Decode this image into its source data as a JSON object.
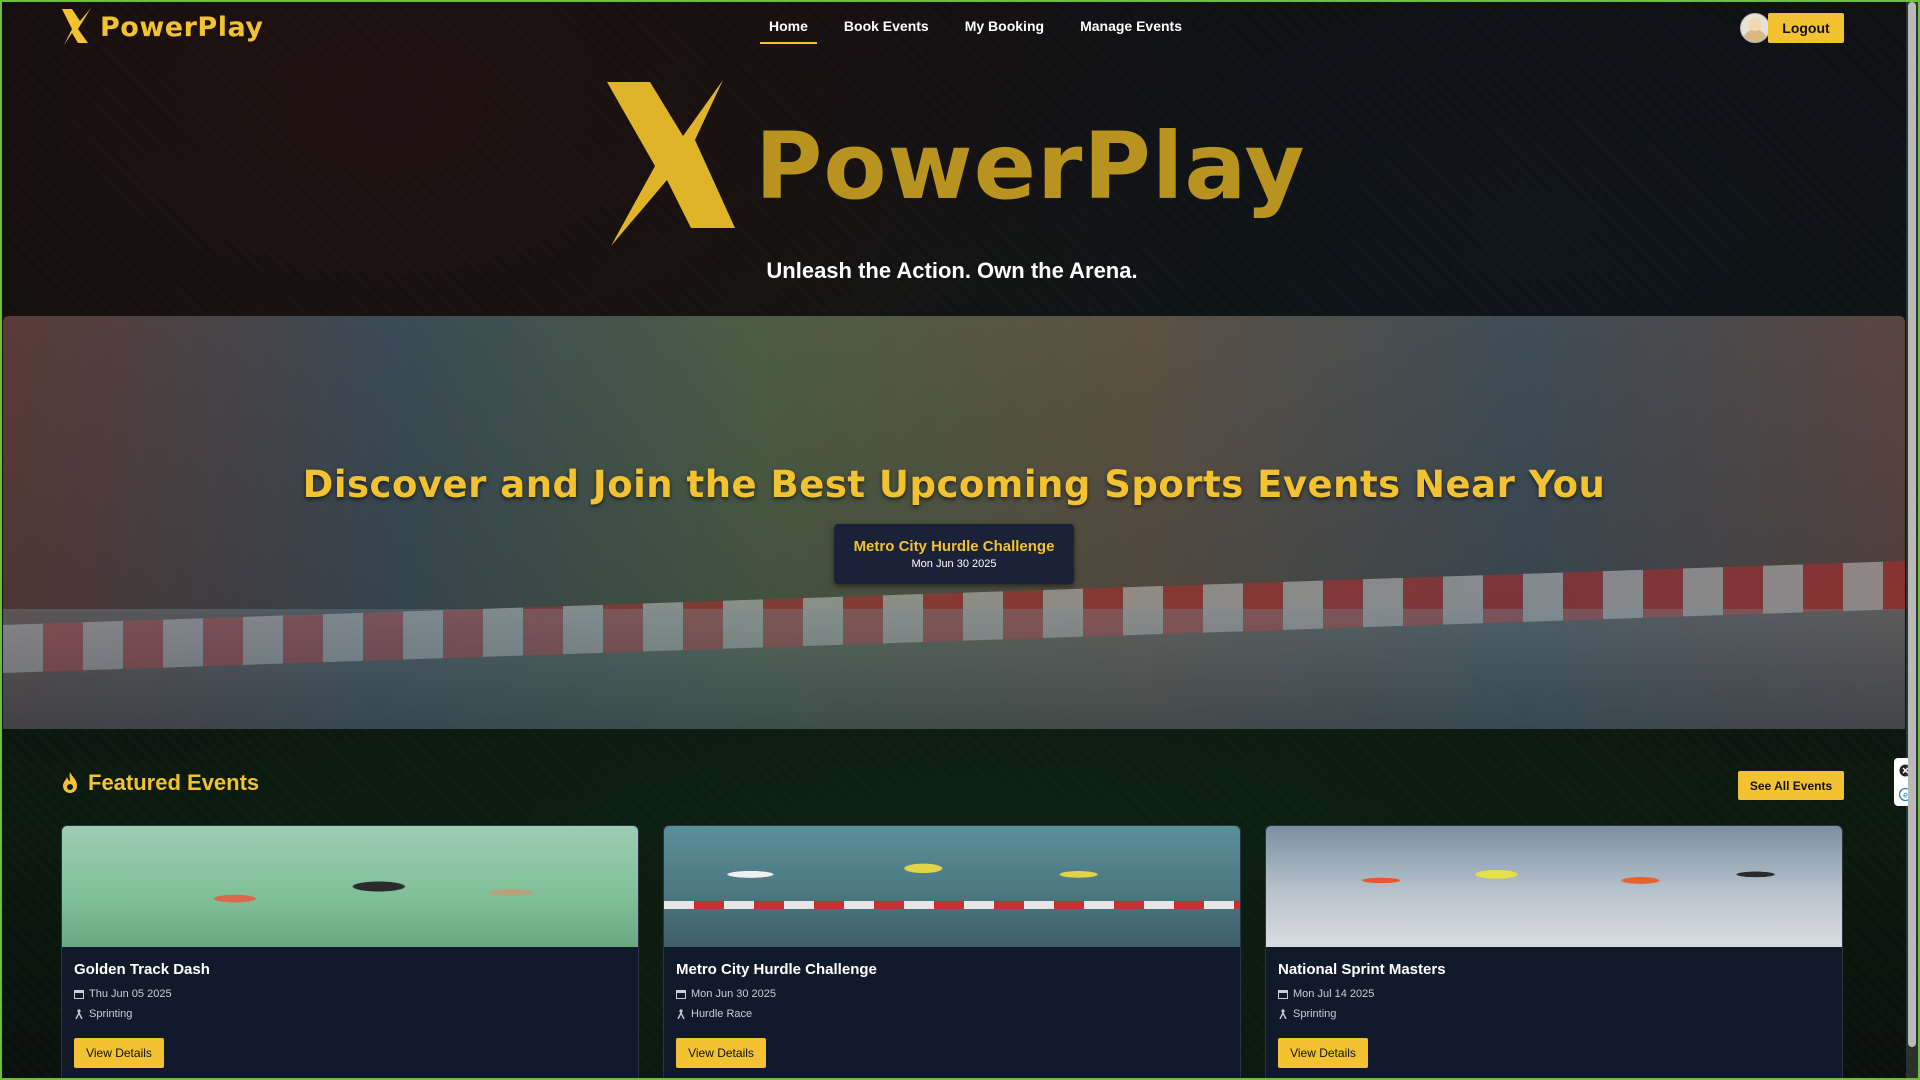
{
  "brand": {
    "name": "PowerPlay"
  },
  "nav": {
    "items": [
      {
        "label": "Home",
        "active": true
      },
      {
        "label": "Book Events",
        "active": false
      },
      {
        "label": "My Booking",
        "active": false
      },
      {
        "label": "Manage Events",
        "active": false
      }
    ],
    "logout_label": "Logout"
  },
  "hero": {
    "name": "PowerPlay",
    "tagline": "Unleash the Action. Own the Arena."
  },
  "banner": {
    "title": "Discover and Join the Best Upcoming Sports Events Near You",
    "event": {
      "title": "Metro City Hurdle Challenge",
      "date": "Mon Jun 30 2025"
    }
  },
  "featured": {
    "title": "Featured Events",
    "see_all_label": "See All Events",
    "events": [
      {
        "title": "Golden Track Dash",
        "date": "Thu Jun 05 2025",
        "category": "Sprinting",
        "button": "View Details"
      },
      {
        "title": "Metro City Hurdle Challenge",
        "date": "Mon Jun 30 2025",
        "category": "Hurdle Race",
        "button": "View Details"
      },
      {
        "title": "National Sprint Masters",
        "date": "Mon Jul 14 2025",
        "category": "Sprinting",
        "button": "View Details"
      }
    ]
  },
  "colors": {
    "accent": "#f2c230",
    "card_bg": "#111a2a",
    "frame": "#6fbf3a"
  },
  "icons": [
    "lightning-x-logo",
    "fire-icon",
    "calendar-icon",
    "runner-icon",
    "avatar"
  ]
}
